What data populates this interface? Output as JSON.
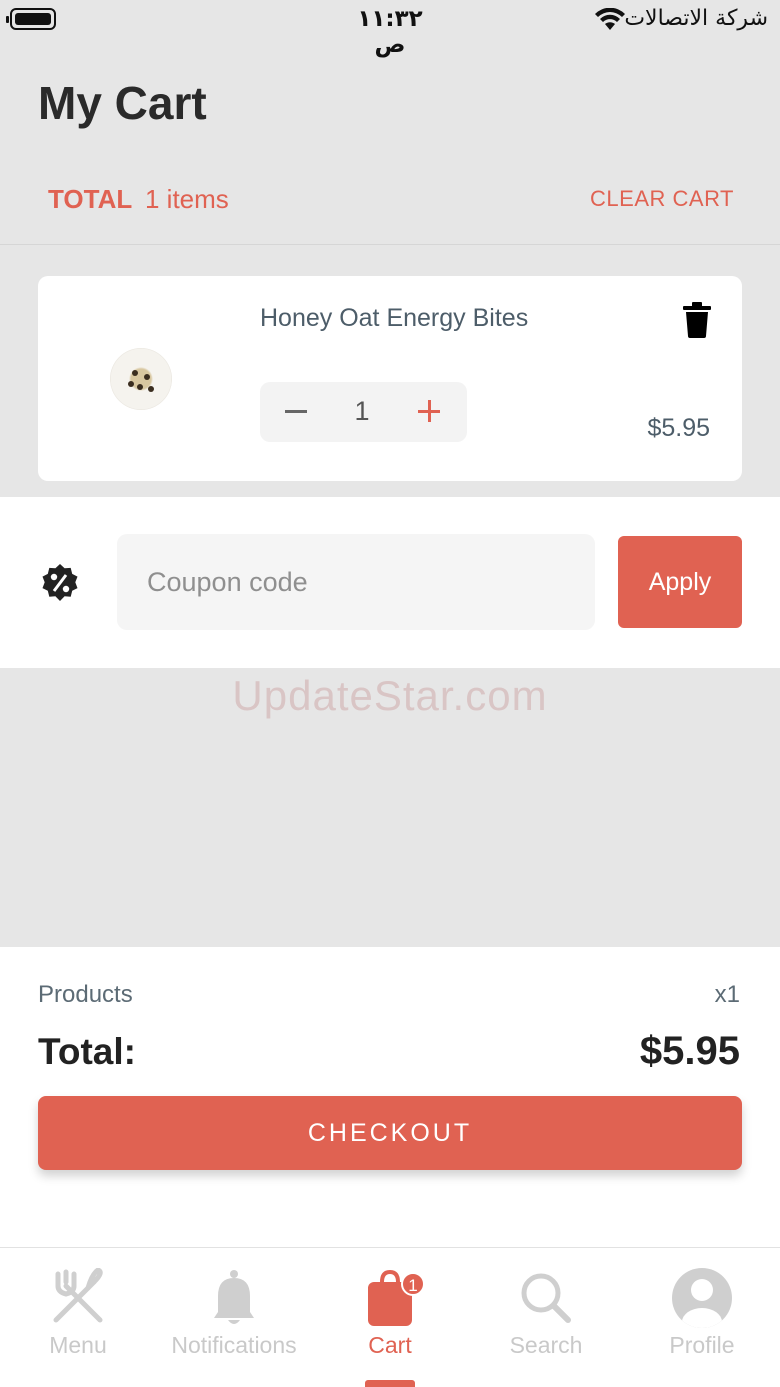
{
  "status_bar": {
    "time": "١١:٣٢ ص",
    "carrier": "شركة الاتصالات"
  },
  "header": {
    "title": "My Cart",
    "total_label": "TOTAL",
    "total_items": "1 items",
    "clear_cart_label": "CLEAR CART"
  },
  "cart_items": [
    {
      "name": "Honey Oat Energy Bites",
      "quantity": "1",
      "price": "$5.95"
    }
  ],
  "coupon": {
    "placeholder": "Coupon code",
    "apply_label": "Apply"
  },
  "watermark": "UpdateStar.com",
  "summary": {
    "products_label": "Products",
    "products_count": "x1",
    "total_label": "Total:",
    "total_value": "$5.95",
    "checkout_label": "CHECKOUT"
  },
  "tab_bar": {
    "tabs": [
      {
        "label": "Menu",
        "icon": "utensils-icon"
      },
      {
        "label": "Notifications",
        "icon": "bell-icon"
      },
      {
        "label": "Cart",
        "icon": "cart-bag-icon",
        "badge": "1"
      },
      {
        "label": "Search",
        "icon": "search-icon"
      },
      {
        "label": "Profile",
        "icon": "user-icon"
      }
    ],
    "active_tab": "Cart"
  },
  "colors": {
    "accent": "#e06252",
    "background": "#e6e6e6",
    "inactive_tab": "#c9c9c9"
  }
}
